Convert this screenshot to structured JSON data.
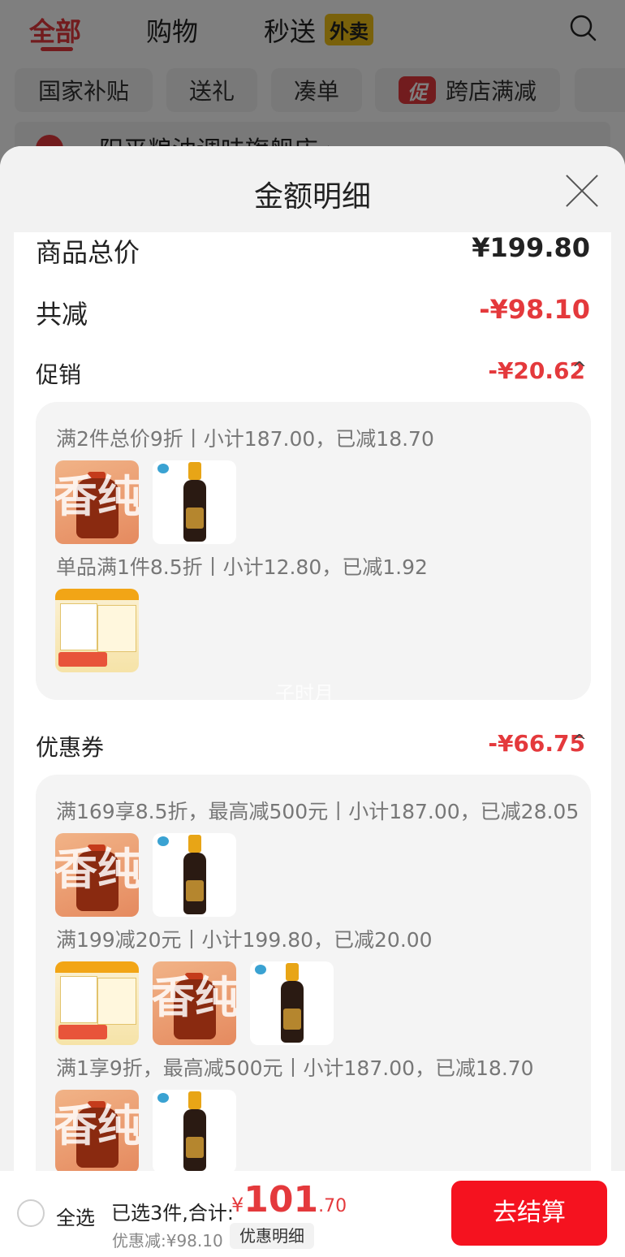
{
  "top_tabs": [
    "全部",
    "购物",
    "秒送"
  ],
  "waimai_badge": "外卖",
  "chips": [
    "国家补贴",
    "送礼",
    "凑单",
    "跨店满减"
  ],
  "chip_cu_badge": "促",
  "store_name": "阳平粮油调味旗舰店 ›",
  "sheet": {
    "title": "金额明细",
    "total_label": "商品总价",
    "total_value": "¥199.80",
    "reduce_label": "共减",
    "reduce_value": "-¥98.10",
    "promo_label": "促销",
    "promo_value": "-¥20.62",
    "promo_rules": [
      "满2件总价9折丨小计187.00，已减18.70",
      "单品满1件8.5折丨小计12.80，已减1.92"
    ],
    "coupon_label": "优惠券",
    "coupon_value": "-¥66.75",
    "coupon_rules": [
      "满169享8.5折，最高减500元丨小计187.00，已减28.05",
      "满199减20元丨小计199.80，已减20.00",
      "满1享9折，最高减500元丨小计187.00，已减18.70"
    ],
    "watermark": "子时月",
    "caret": "^"
  },
  "thumb_labels": {
    "oil_char1": "香",
    "oil_char2": "纯"
  },
  "bottom": {
    "select_all": "全选",
    "selected_text": "已选3件,合计:",
    "price_symbol": "¥",
    "price_int": "101",
    "price_dec": ".70",
    "discount_text": "优惠减:¥98.10",
    "detail_btn": "优惠明细",
    "checkout_btn": "去结算"
  },
  "colors": {
    "accent": "#e4393c",
    "checkout": "#f5121f"
  }
}
